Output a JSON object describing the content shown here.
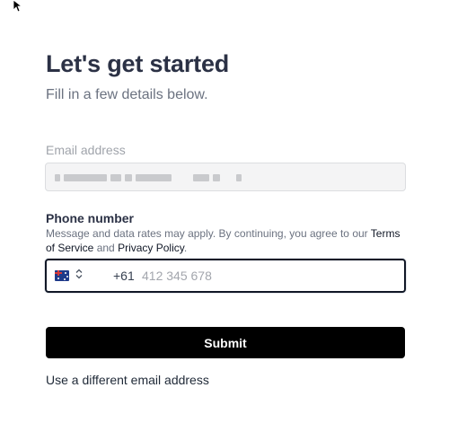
{
  "header": {
    "title": "Let's get started",
    "subtitle": "Fill in a few details below."
  },
  "email": {
    "label": "Email address"
  },
  "phone": {
    "label": "Phone number",
    "disclaimer_prefix": "Message and data rates may apply. By continuing, you agree to our ",
    "terms_link": "Terms of Service",
    "and_text": " and ",
    "privacy_link": "Privacy Policy",
    "period": ".",
    "country_flag": "australia-flag-icon",
    "country_code": "+61",
    "placeholder": "412 345 678",
    "value": ""
  },
  "actions": {
    "submit_label": "Submit",
    "alt_link": "Use a different email address"
  },
  "colors": {
    "primary_button": "#000000",
    "title": "#2b3145",
    "muted": "#6b7280"
  }
}
